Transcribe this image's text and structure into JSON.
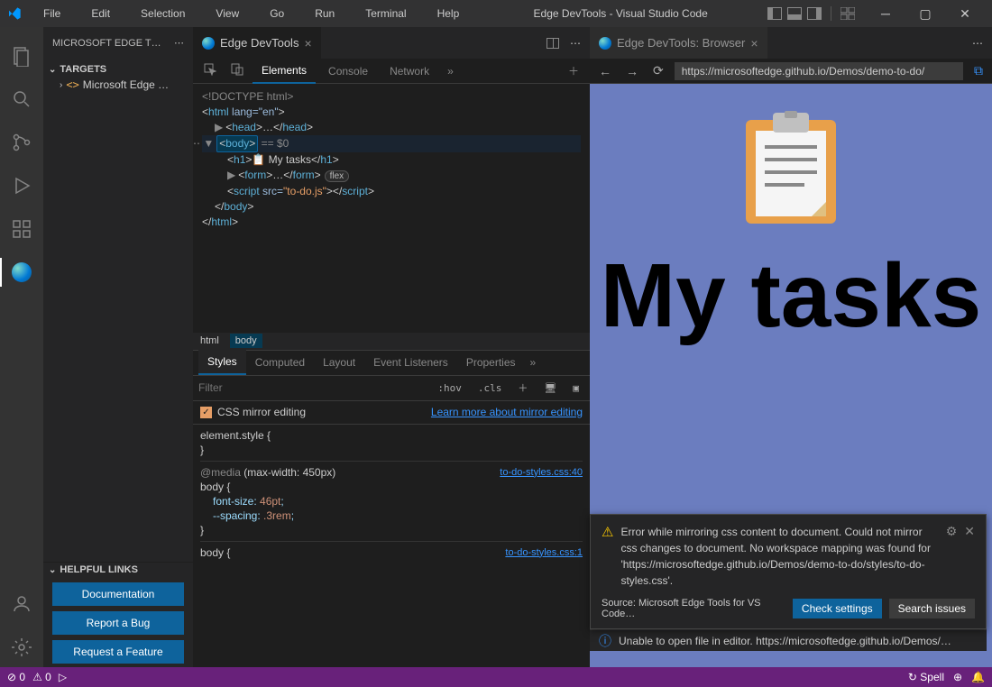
{
  "titlebar": {
    "menus": [
      "File",
      "Edit",
      "Selection",
      "View",
      "Go",
      "Run",
      "Terminal",
      "Help"
    ],
    "title": "Edge DevTools - Visual Studio Code"
  },
  "sidebar": {
    "title": "MICROSOFT EDGE T…",
    "targets_label": "TARGETS",
    "target_item": "Microsoft Edge …",
    "helpful_label": "HELPFUL LINKS",
    "buttons": {
      "doc": "Documentation",
      "bug": "Report a Bug",
      "feat": "Request a Feature"
    }
  },
  "group1": {
    "tab_label": "Edge DevTools",
    "devtools_tabs": {
      "elements": "Elements",
      "console": "Console",
      "network": "Network"
    },
    "dom": {
      "doctype": "<!DOCTYPE html>",
      "html_open": "html",
      "lang": "lang=\"en\"",
      "head": "head",
      "head_ell": "…",
      "body": "body",
      "body_hint": "== $0",
      "h1": "h1",
      "h1_emoji": "📋",
      "h1_text": " My tasks",
      "form": "form",
      "form_ell": "…",
      "flex_badge": "flex",
      "script": "script",
      "src": "src=",
      "src_val": "\"to-do.js\"",
      "html_close": "html"
    },
    "breadcrumb": {
      "html": "html",
      "body": "body"
    },
    "styles_tabs": {
      "styles": "Styles",
      "computed": "Computed",
      "layout": "Layout",
      "event": "Event Listeners",
      "props": "Properties"
    },
    "filter": {
      "placeholder": "Filter",
      "hov": ":hov",
      "cls": ".cls"
    },
    "mirror": {
      "label": "CSS mirror editing",
      "learn": "Learn more about mirror editing"
    },
    "css": {
      "rule1_sel": "element.style",
      "media": "@media",
      "media_q": "(max-width: 450px)",
      "rule2_sel": "body",
      "font_size_prop": "font-size",
      "font_size_val": "46pt",
      "spacing_prop": "--spacing",
      "spacing_val": ".3rem",
      "link1": "to-do-styles.css:40",
      "rule3_sel": "body",
      "link2": "to-do-styles.css:1"
    }
  },
  "group2": {
    "tab_label": "Edge DevTools: Browser",
    "url": "https://microsoftedge.github.io/Demos/demo-to-do/",
    "page_title": "My tasks"
  },
  "notification": {
    "message": "Error while mirroring css content to document. Could not mirror css changes to document. No workspace mapping was found for 'https://microsoftedge.github.io/Demos/demo-to-do/styles/to-do-styles.css'.",
    "source": "Source: Microsoft Edge Tools for VS Code…",
    "check": "Check settings",
    "search": "Search issues"
  },
  "status_error": "Unable to open file in editor. https://microsoftedge.github.io/Demos/…",
  "statusbar": {
    "errors": "0",
    "warnings": "0",
    "spell": "Spell"
  }
}
